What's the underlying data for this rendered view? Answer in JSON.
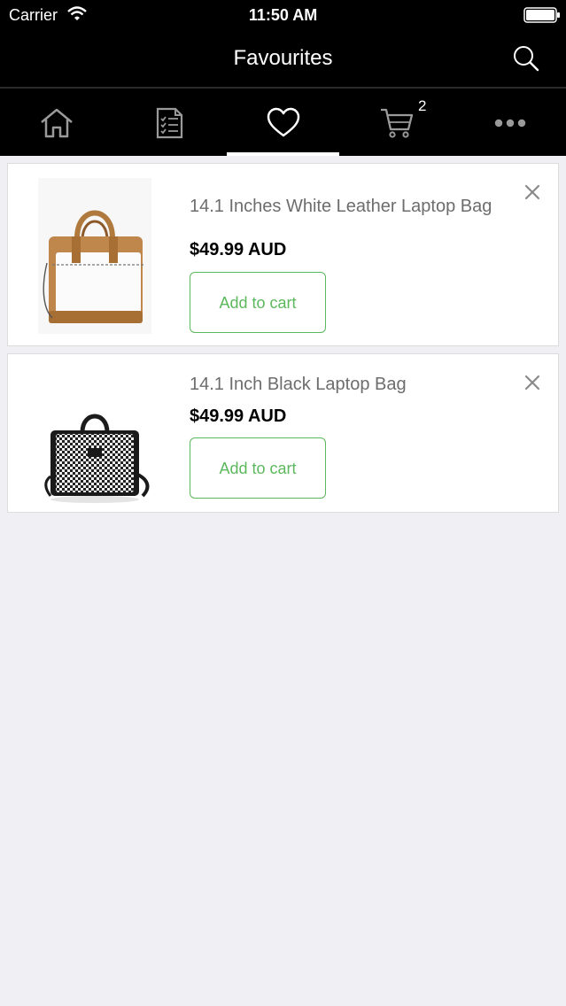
{
  "status_bar": {
    "carrier": "Carrier",
    "time": "11:50 AM"
  },
  "nav": {
    "title": "Favourites",
    "search_icon": "search-icon"
  },
  "tabs": [
    {
      "icon": "home-icon",
      "active": false
    },
    {
      "icon": "checklist-icon",
      "active": false
    },
    {
      "icon": "heart-icon",
      "active": true
    },
    {
      "icon": "cart-icon",
      "active": false,
      "badge": "2"
    },
    {
      "icon": "more-icon",
      "active": false
    }
  ],
  "favourites": [
    {
      "title": "14.1 Inches White Leather Laptop Bag",
      "price": "$49.99 AUD",
      "add_label": "Add to cart",
      "image": "white-leather-bag"
    },
    {
      "title": "14.1 Inch Black Laptop Bag",
      "price": "$49.99 AUD",
      "add_label": "Add to cart",
      "image": "black-houndstooth-bag"
    }
  ],
  "colors": {
    "bar": "#000000",
    "accent": "#5cb85c",
    "page_bg": "#efeff4"
  }
}
